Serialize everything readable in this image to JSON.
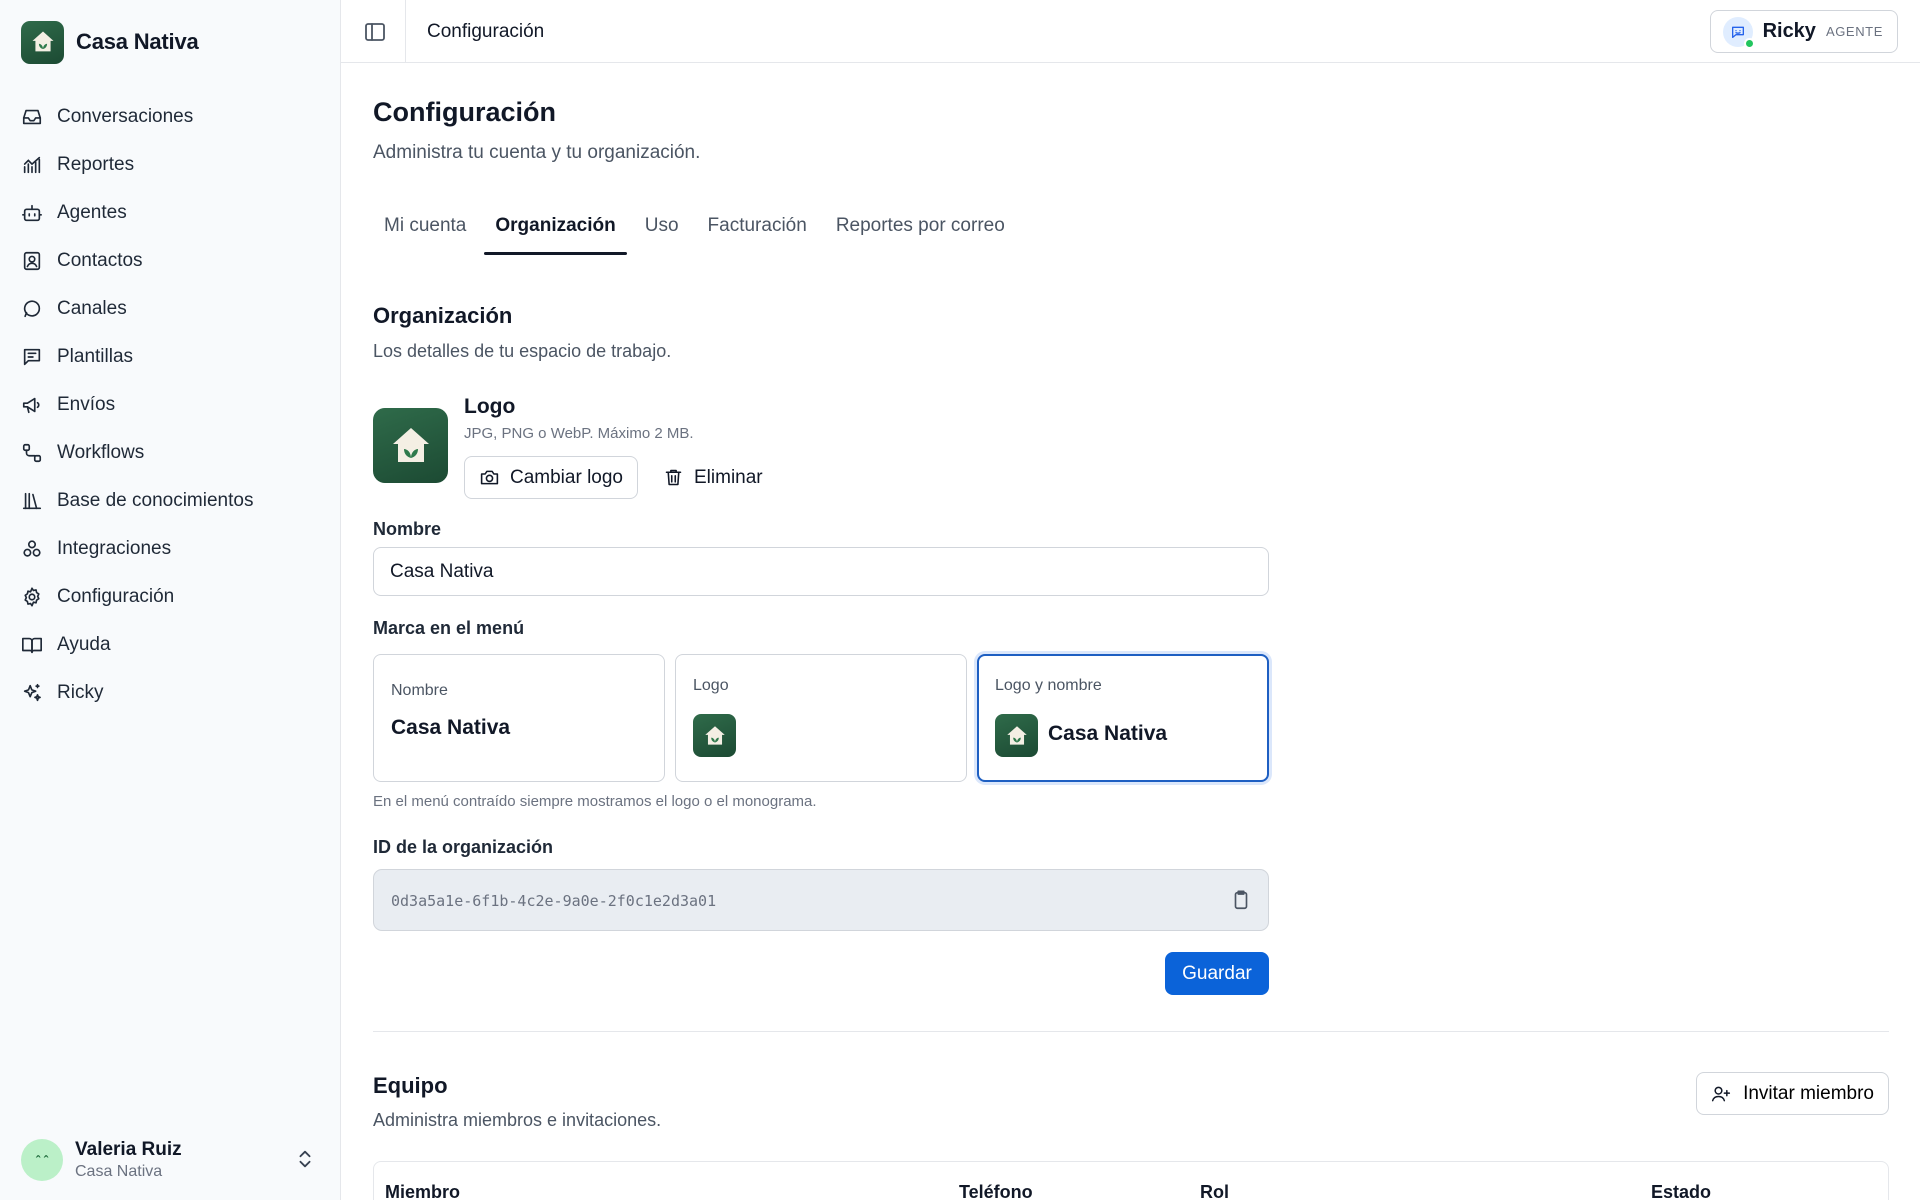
{
  "brand": {
    "name": "Casa Nativa"
  },
  "sidebar": {
    "items": [
      {
        "label": "Conversaciones",
        "icon": "inbox-icon"
      },
      {
        "label": "Reportes",
        "icon": "chart-icon"
      },
      {
        "label": "Agentes",
        "icon": "bot-icon"
      },
      {
        "label": "Contactos",
        "icon": "contact-icon"
      },
      {
        "label": "Canales",
        "icon": "chat-bubble-icon"
      },
      {
        "label": "Plantillas",
        "icon": "template-icon"
      },
      {
        "label": "Envíos",
        "icon": "megaphone-icon"
      },
      {
        "label": "Workflows",
        "icon": "workflow-icon"
      },
      {
        "label": "Base de conocimientos",
        "icon": "library-icon"
      },
      {
        "label": "Integraciones",
        "icon": "integrations-icon"
      },
      {
        "label": "Configuración",
        "icon": "gear-icon"
      },
      {
        "label": "Ayuda",
        "icon": "book-icon"
      },
      {
        "label": "Ricky",
        "icon": "sparkles-icon"
      }
    ],
    "user": {
      "initials": "ˆ ˆ",
      "name": "Valeria Ruiz",
      "org": "Casa Nativa"
    }
  },
  "topbar": {
    "title": "Configuración",
    "agent": {
      "name": "Ricky",
      "role": "AGENTE"
    }
  },
  "page": {
    "title": "Configuración",
    "subtitle": "Administra tu cuenta y tu organización.",
    "tabs": [
      {
        "label": "Mi cuenta",
        "active": false
      },
      {
        "label": "Organización",
        "active": true
      },
      {
        "label": "Uso",
        "active": false
      },
      {
        "label": "Facturación",
        "active": false
      },
      {
        "label": "Reportes por correo",
        "active": false
      }
    ]
  },
  "org": {
    "title": "Organización",
    "subtitle": "Los detalles de tu espacio de trabajo.",
    "logo": {
      "title": "Logo",
      "hint": "JPG, PNG o WebP. Máximo 2 MB.",
      "change_label": "Cambiar logo",
      "remove_label": "Eliminar"
    },
    "name_label": "Nombre",
    "name_value": "Casa Nativa",
    "brand_label": "Marca en el menú",
    "brand_options": [
      {
        "label": "Nombre",
        "name": "Casa Nativa",
        "selected": false
      },
      {
        "label": "Logo",
        "selected": false
      },
      {
        "label": "Logo y nombre",
        "name": "Casa Nativa",
        "selected": true
      }
    ],
    "brand_hint": "En el menú contraído siempre mostramos el logo o el monograma.",
    "id_label": "ID de la organización",
    "id_value": "0d3a5a1e-6f1b-4c2e-9a0e-2f0c1e2d3a01",
    "save_label": "Guardar"
  },
  "team": {
    "title": "Equipo",
    "subtitle": "Administra miembros e invitaciones.",
    "invite_label": "Invitar miembro",
    "columns": [
      "Miembro",
      "Teléfono",
      "Rol",
      "Estado"
    ]
  },
  "colors": {
    "accent": "#0b63d9",
    "brand_green": "#245a3e",
    "selected_border": "#1e5fc2"
  }
}
